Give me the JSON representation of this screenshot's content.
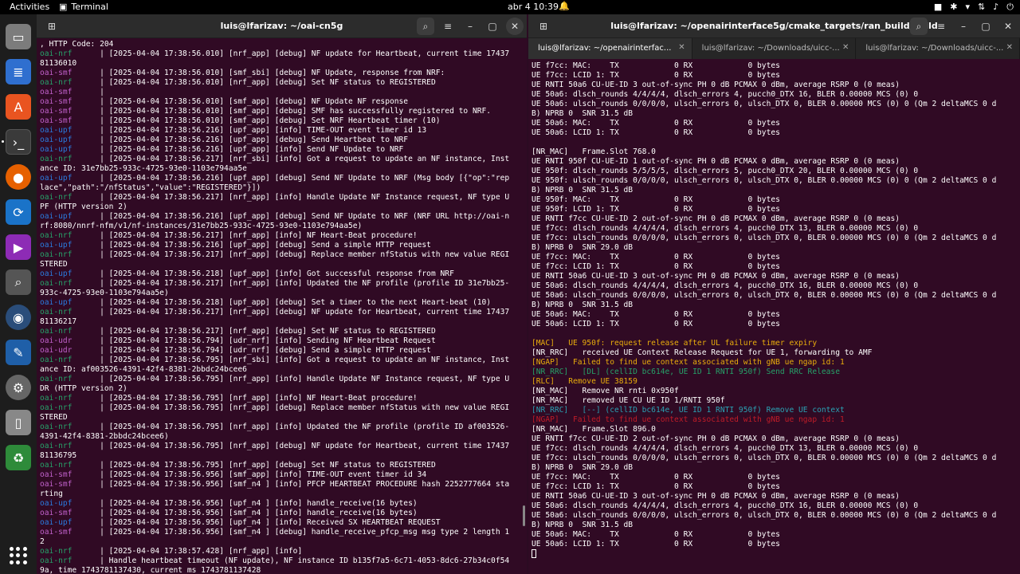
{
  "topbar": {
    "activities": "Activities",
    "app_name": "Terminal",
    "clock": "abr 4  10:39"
  },
  "dock": {
    "items": [
      "files-icon",
      "text-editor-icon",
      "app-center-icon",
      "terminal-icon",
      "firefox-icon",
      "software-updater-icon",
      "video-player-icon",
      "image-viewer-icon",
      "eye-icon",
      "notes-icon",
      "settings-icon",
      "usb-drive-icon",
      "trash-icon"
    ]
  },
  "left_window": {
    "title": "luis@lfarizav: ~/oai-cn5g",
    "lines": [
      [
        [
          ", HTTP Code: 204",
          "w"
        ]
      ],
      [
        [
          "oai-nrf",
          "g"
        ],
        [
          "      | [2025-04-04 17:38:56.010] [nrf_app] [debug] NF update for Heartbeat, current time 17437",
          "w"
        ]
      ],
      [
        [
          "81136010",
          "w"
        ]
      ],
      [
        [
          "oai-smf",
          "p"
        ],
        [
          "      | [2025-04-04 17:38:56.010] [smf_sbi] [debug] NF Update, response from NRF:",
          "w"
        ]
      ],
      [
        [
          "oai-nrf",
          "g"
        ],
        [
          "      | [2025-04-04 17:38:56.010] [nrf_app] [debug] Set NF status to REGISTERED",
          "w"
        ]
      ],
      [
        [
          "oai-smf",
          "p"
        ],
        [
          "      |",
          "w"
        ]
      ],
      [
        [
          "oai-smf",
          "p"
        ],
        [
          "      | [2025-04-04 17:38:56.010] [smf_app] [debug] NF Update NF response",
          "w"
        ]
      ],
      [
        [
          "oai-smf",
          "p"
        ],
        [
          "      | [2025-04-04 17:38:56.010] [smf_app] [debug] SMF has successfully registered to NRF.",
          "w"
        ]
      ],
      [
        [
          "oai-smf",
          "p"
        ],
        [
          "      | [2025-04-04 17:38:56.010] [smf_app] [debug] Set NRF Heartbeat timer (10)",
          "w"
        ]
      ],
      [
        [
          "oai-upf",
          "b"
        ],
        [
          "      | [2025-04-04 17:38:56.216] [upf_app] [info] TIME-OUT event timer id 13",
          "w"
        ]
      ],
      [
        [
          "oai-upf",
          "b"
        ],
        [
          "      | [2025-04-04 17:38:56.216] [upf_app] [debug] Send Heartbeat to NRF",
          "w"
        ]
      ],
      [
        [
          "oai-upf",
          "b"
        ],
        [
          "      | [2025-04-04 17:38:56.216] [upf_app] [info] Send NF Update to NRF",
          "w"
        ]
      ],
      [
        [
          "oai-nrf",
          "g"
        ],
        [
          "      | [2025-04-04 17:38:56.217] [nrf_sbi] [info] Got a request to update an NF instance, Inst",
          "w"
        ]
      ],
      [
        [
          "ance ID: 31e7bb25-933c-4725-93e0-1103e794aa5e",
          "w"
        ]
      ],
      [
        [
          "oai-upf",
          "b"
        ],
        [
          "      | [2025-04-04 17:38:56.216] [upf_app] [debug] Send NF Update to NRF (Msg body [{\"op\":\"rep",
          "w"
        ]
      ],
      [
        [
          "lace\",\"path\":\"/nfStatus\",\"value\":\"REGISTERED\"}])",
          "w"
        ]
      ],
      [
        [
          "oai-nrf",
          "g"
        ],
        [
          "      | [2025-04-04 17:38:56.217] [nrf_app] [info] Handle Update NF Instance request, NF type U",
          "w"
        ]
      ],
      [
        [
          "PF (HTTP version 2)",
          "w"
        ]
      ],
      [
        [
          "oai-upf",
          "b"
        ],
        [
          "      | [2025-04-04 17:38:56.216] [upf_app] [debug] Send NF Update to NRF (NRF URL http://oai-n",
          "w"
        ]
      ],
      [
        [
          "rf:8080/nnrf-nfm/v1/nf-instances/31e7bb25-933c-4725-93e0-1103e794aa5e)",
          "w"
        ]
      ],
      [
        [
          "oai-nrf",
          "g"
        ],
        [
          "      | [2025-04-04 17:38:56.217] [nrf_app] [info] NF Heart-Beat procedure!",
          "w"
        ]
      ],
      [
        [
          "oai-upf",
          "b"
        ],
        [
          "      | [2025-04-04 17:38:56.216] [upf_app] [debug] Send a simple HTTP request",
          "w"
        ]
      ],
      [
        [
          "oai-nrf",
          "g"
        ],
        [
          "      | [2025-04-04 17:38:56.217] [nrf_app] [debug] Replace member nfStatus with new value REGI",
          "w"
        ]
      ],
      [
        [
          "STERED",
          "w"
        ]
      ],
      [
        [
          "oai-upf",
          "b"
        ],
        [
          "      | [2025-04-04 17:38:56.218] [upf_app] [info] Got successful response from NRF",
          "w"
        ]
      ],
      [
        [
          "oai-nrf",
          "g"
        ],
        [
          "      | [2025-04-04 17:38:56.217] [nrf_app] [info] Updated the NF profile (profile ID 31e7bb25-",
          "w"
        ]
      ],
      [
        [
          "933c-4725-93e0-1103e794aa5e)",
          "w"
        ]
      ],
      [
        [
          "oai-upf",
          "b"
        ],
        [
          "      | [2025-04-04 17:38:56.218] [upf_app] [debug] Set a timer to the next Heart-beat (10)",
          "w"
        ]
      ],
      [
        [
          "oai-nrf",
          "g"
        ],
        [
          "      | [2025-04-04 17:38:56.217] [nrf_app] [debug] NF update for Heartbeat, current time 17437",
          "w"
        ]
      ],
      [
        [
          "81136217",
          "w"
        ]
      ],
      [
        [
          "oai-nrf",
          "g"
        ],
        [
          "      | [2025-04-04 17:38:56.217] [nrf_app] [debug] Set NF status to REGISTERED",
          "w"
        ]
      ],
      [
        [
          "oai-udr",
          "p"
        ],
        [
          "      | [2025-04-04 17:38:56.794] [udr_nrf] [info] Sending NF Heartbeat Request",
          "w"
        ]
      ],
      [
        [
          "oai-udr",
          "p"
        ],
        [
          "      | [2025-04-04 17:38:56.794] [udr_nrf] [debug] Send a simple HTTP request",
          "w"
        ]
      ],
      [
        [
          "oai-nrf",
          "g"
        ],
        [
          "      | [2025-04-04 17:38:56.795] [nrf_sbi] [info] Got a request to update an NF instance, Inst",
          "w"
        ]
      ],
      [
        [
          "ance ID: af003526-4391-42f4-8381-2bbdc24bcee6",
          "w"
        ]
      ],
      [
        [
          "oai-nrf",
          "g"
        ],
        [
          "      | [2025-04-04 17:38:56.795] [nrf_app] [info] Handle Update NF Instance request, NF type U",
          "w"
        ]
      ],
      [
        [
          "DR (HTTP version 2)",
          "w"
        ]
      ],
      [
        [
          "oai-nrf",
          "g"
        ],
        [
          "      | [2025-04-04 17:38:56.795] [nrf_app] [info] NF Heart-Beat procedure!",
          "w"
        ]
      ],
      [
        [
          "oai-nrf",
          "g"
        ],
        [
          "      | [2025-04-04 17:38:56.795] [nrf_app] [debug] Replace member nfStatus with new value REGI",
          "w"
        ]
      ],
      [
        [
          "STERED",
          "w"
        ]
      ],
      [
        [
          "oai-nrf",
          "g"
        ],
        [
          "      | [2025-04-04 17:38:56.795] [nrf_app] [info] Updated the NF profile (profile ID af003526-",
          "w"
        ]
      ],
      [
        [
          "4391-42f4-8381-2bbdc24bcee6)",
          "w"
        ]
      ],
      [
        [
          "oai-nrf",
          "g"
        ],
        [
          "      | [2025-04-04 17:38:56.795] [nrf_app] [debug] NF update for Heartbeat, current time 17437",
          "w"
        ]
      ],
      [
        [
          "81136795",
          "w"
        ]
      ],
      [
        [
          "oai-nrf",
          "g"
        ],
        [
          "      | [2025-04-04 17:38:56.795] [nrf_app] [debug] Set NF status to REGISTERED",
          "w"
        ]
      ],
      [
        [
          "oai-smf",
          "p"
        ],
        [
          "      | [2025-04-04 17:38:56.956] [smf_app] [info] TIME-OUT event timer id 34",
          "w"
        ]
      ],
      [
        [
          "oai-smf",
          "p"
        ],
        [
          "      | [2025-04-04 17:38:56.956] [smf_n4 ] [info] PFCP HEARTBEAT PROCEDURE hash 2252777664 sta",
          "w"
        ]
      ],
      [
        [
          "rting",
          "w"
        ]
      ],
      [
        [
          "oai-upf",
          "b"
        ],
        [
          "      | [2025-04-04 17:38:56.956] [upf_n4 ] [info] handle_receive(16 bytes)",
          "w"
        ]
      ],
      [
        [
          "oai-smf",
          "p"
        ],
        [
          "      | [2025-04-04 17:38:56.956] [smf_n4 ] [info] handle_receive(16 bytes)",
          "w"
        ]
      ],
      [
        [
          "oai-upf",
          "b"
        ],
        [
          "      | [2025-04-04 17:38:56.956] [upf_n4 ] [info] Received SX HEARTBEAT REQUEST",
          "w"
        ]
      ],
      [
        [
          "oai-smf",
          "p"
        ],
        [
          "      | [2025-04-04 17:38:56.956] [smf_n4 ] [debug] handle_receive_pfcp_msg msg type 2 length 1",
          "w"
        ]
      ],
      [
        [
          "2",
          "w"
        ]
      ],
      [
        [
          "oai-nrf",
          "g"
        ],
        [
          "      | [2025-04-04 17:38:57.428] [nrf_app] [info]",
          "w"
        ]
      ],
      [
        [
          "oai-nrf",
          "g"
        ],
        [
          "      | Handle heartbeat timeout (NF update), NF instance ID b135f7a5-6c71-4053-8dc6-27b34c0f54",
          "w"
        ]
      ],
      [
        [
          "9a, time 1743781137430, current ms 1743781137428",
          "w"
        ]
      ]
    ]
  },
  "right_window": {
    "title": "luis@lfarizav: ~/openairinterface5g/cmake_targets/ran_build/build",
    "tabs": [
      "luis@lfarizav: ~/openairinterfac...",
      "luis@lfarizav: ~/Downloads/uicc-...",
      "luis@lfarizav: ~/Downloads/uicc-..."
    ],
    "lines": [
      [
        [
          "UE f7cc: MAC:    TX            0 RX            0 bytes",
          "w"
        ]
      ],
      [
        [
          "UE f7cc: LCID 1: TX            0 RX            0 bytes",
          "w"
        ]
      ],
      [
        [
          "UE RNTI 50a6 CU-UE-ID 3 out-of-sync PH 0 dB PCMAX 0 dBm, average RSRP 0 (0 meas)",
          "w"
        ]
      ],
      [
        [
          "UE 50a6: dlsch_rounds 4/4/4/4, dlsch_errors 4, pucch0_DTX 16, BLER 0.00000 MCS (0) 0",
          "w"
        ]
      ],
      [
        [
          "UE 50a6: ulsch_rounds 0/0/0/0, ulsch_errors 0, ulsch_DTX 0, BLER 0.00000 MCS (0) 0 (Qm 2 deltaMCS 0 d",
          "w"
        ]
      ],
      [
        [
          "B) NPRB 0  SNR 31.5 dB",
          "w"
        ]
      ],
      [
        [
          "UE 50a6: MAC:    TX            0 RX            0 bytes",
          "w"
        ]
      ],
      [
        [
          "UE 50a6: LCID 1: TX            0 RX            0 bytes",
          "w"
        ]
      ],
      [
        [
          "",
          "w"
        ]
      ],
      [
        [
          "[NR_MAC]   Frame.Slot 768.0",
          "w"
        ]
      ],
      [
        [
          "UE RNTI 950f CU-UE-ID 1 out-of-sync PH 0 dB PCMAX 0 dBm, average RSRP 0 (0 meas)",
          "w"
        ]
      ],
      [
        [
          "UE 950f: dlsch_rounds 5/5/5/5, dlsch_errors 5, pucch0_DTX 20, BLER 0.00000 MCS (0) 0",
          "w"
        ]
      ],
      [
        [
          "UE 950f: ulsch_rounds 0/0/0/0, ulsch_errors 0, ulsch_DTX 0, BLER 0.00000 MCS (0) 0 (Qm 2 deltaMCS 0 d",
          "w"
        ]
      ],
      [
        [
          "B) NPRB 0  SNR 31.5 dB",
          "w"
        ]
      ],
      [
        [
          "UE 950f: MAC:    TX            0 RX            0 bytes",
          "w"
        ]
      ],
      [
        [
          "UE 950f: LCID 1: TX            0 RX            0 bytes",
          "w"
        ]
      ],
      [
        [
          "UE RNTI f7cc CU-UE-ID 2 out-of-sync PH 0 dB PCMAX 0 dBm, average RSRP 0 (0 meas)",
          "w"
        ]
      ],
      [
        [
          "UE f7cc: dlsch_rounds 4/4/4/4, dlsch_errors 4, pucch0_DTX 13, BLER 0.00000 MCS (0) 0",
          "w"
        ]
      ],
      [
        [
          "UE f7cc: ulsch_rounds 0/0/0/0, ulsch_errors 0, ulsch_DTX 0, BLER 0.00000 MCS (0) 0 (Qm 2 deltaMCS 0 d",
          "w"
        ]
      ],
      [
        [
          "B) NPRB 0  SNR 29.0 dB",
          "w"
        ]
      ],
      [
        [
          "UE f7cc: MAC:    TX            0 RX            0 bytes",
          "w"
        ]
      ],
      [
        [
          "UE f7cc: LCID 1: TX            0 RX            0 bytes",
          "w"
        ]
      ],
      [
        [
          "UE RNTI 50a6 CU-UE-ID 3 out-of-sync PH 0 dB PCMAX 0 dBm, average RSRP 0 (0 meas)",
          "w"
        ]
      ],
      [
        [
          "UE 50a6: dlsch_rounds 4/4/4/4, dlsch_errors 4, pucch0_DTX 16, BLER 0.00000 MCS (0) 0",
          "w"
        ]
      ],
      [
        [
          "UE 50a6: ulsch_rounds 0/0/0/0, ulsch_errors 0, ulsch_DTX 0, BLER 0.00000 MCS (0) 0 (Qm 2 deltaMCS 0 d",
          "w"
        ]
      ],
      [
        [
          "B) NPRB 0  SNR 31.5 dB",
          "w"
        ]
      ],
      [
        [
          "UE 50a6: MAC:    TX            0 RX            0 bytes",
          "w"
        ]
      ],
      [
        [
          "UE 50a6: LCID 1: TX            0 RX            0 bytes",
          "w"
        ]
      ],
      [
        [
          "",
          "w"
        ]
      ],
      [
        [
          "[MAC]   UE 950f: request release after UL failure timer expiry",
          "y"
        ]
      ],
      [
        [
          "[NR_RRC]   received UE Context Release Request for UE 1, forwarding to AMF",
          "w"
        ]
      ],
      [
        [
          "[NGAP]   Failed to find ue context associated with gNB ue ngap id: 1",
          "y"
        ]
      ],
      [
        [
          "[NR_RRC]   [DL] (cellID bc614e, UE ID 1 RNTI 950f) Send RRC Release",
          "g"
        ]
      ],
      [
        [
          "[RLC]   Remove UE 38159",
          "y"
        ]
      ],
      [
        [
          "[NR_MAC]   Remove NR rnti 0x950f",
          "w"
        ]
      ],
      [
        [
          "[NR_MAC]   removed UE CU UE ID 1/RNTI 950f",
          "w"
        ]
      ],
      [
        [
          "[NR_RRC]   [--] (cellID bc614e, UE ID 1 RNTI 950f) Remove UE context",
          "cy"
        ]
      ],
      [
        [
          "[NGAP]   Failed to find ue context associated with gNB ue ngap id: 1",
          "r"
        ]
      ],
      [
        [
          "[NR_MAC]   Frame.Slot 896.0",
          "w"
        ]
      ],
      [
        [
          "UE RNTI f7cc CU-UE-ID 2 out-of-sync PH 0 dB PCMAX 0 dBm, average RSRP 0 (0 meas)",
          "w"
        ]
      ],
      [
        [
          "UE f7cc: dlsch_rounds 4/4/4/4, dlsch_errors 4, pucch0_DTX 13, BLER 0.00000 MCS (0) 0",
          "w"
        ]
      ],
      [
        [
          "UE f7cc: ulsch_rounds 0/0/0/0, ulsch_errors 0, ulsch_DTX 0, BLER 0.00000 MCS (0) 0 (Qm 2 deltaMCS 0 d",
          "w"
        ]
      ],
      [
        [
          "B) NPRB 0  SNR 29.0 dB",
          "w"
        ]
      ],
      [
        [
          "UE f7cc: MAC:    TX            0 RX            0 bytes",
          "w"
        ]
      ],
      [
        [
          "UE f7cc: LCID 1: TX            0 RX            0 bytes",
          "w"
        ]
      ],
      [
        [
          "UE RNTI 50a6 CU-UE-ID 3 out-of-sync PH 0 dB PCMAX 0 dBm, average RSRP 0 (0 meas)",
          "w"
        ]
      ],
      [
        [
          "UE 50a6: dlsch_rounds 4/4/4/4, dlsch_errors 4, pucch0_DTX 16, BLER 0.00000 MCS (0) 0",
          "w"
        ]
      ],
      [
        [
          "UE 50a6: ulsch_rounds 0/0/0/0, ulsch_errors 0, ulsch_DTX 0, BLER 0.00000 MCS (0) 0 (Qm 2 deltaMCS 0 d",
          "w"
        ]
      ],
      [
        [
          "B) NPRB 0  SNR 31.5 dB",
          "w"
        ]
      ],
      [
        [
          "UE 50a6: MAC:    TX            0 RX            0 bytes",
          "w"
        ]
      ],
      [
        [
          "UE 50a6: LCID 1: TX            0 RX            0 bytes",
          "w"
        ]
      ]
    ]
  }
}
